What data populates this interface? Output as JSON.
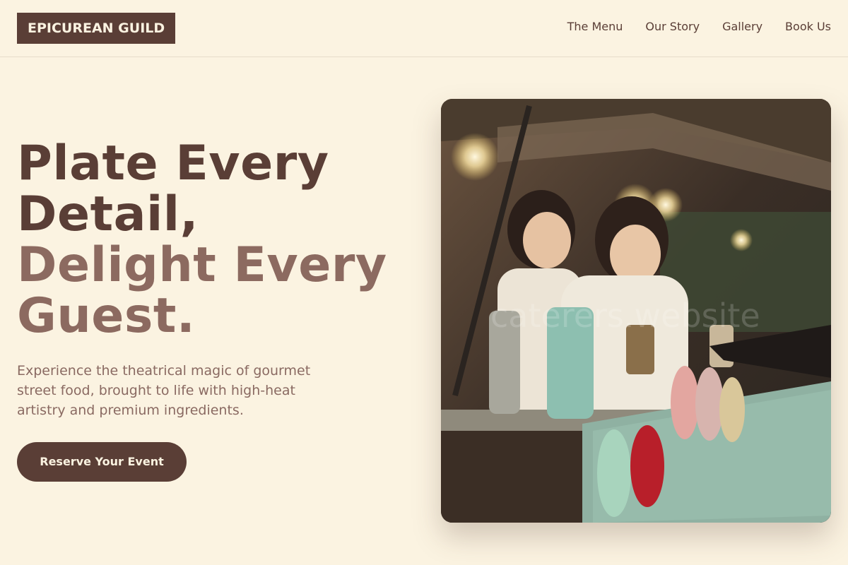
{
  "header": {
    "logo": "EPICUREAN GUILD",
    "nav": [
      "The Menu",
      "Our Story",
      "Gallery",
      "Book Us"
    ]
  },
  "hero": {
    "headline_lines": [
      "Plate Every",
      "Detail,",
      "Delight Every",
      "Guest."
    ],
    "subtitle": "Experience the theatrical magic of gourmet street food, brought to life with high-heat artistry and premium ingredients.",
    "cta_label": "Reserve Your Event",
    "image_alt": "Chefs serving at a street food stall",
    "watermark": "caterers.website"
  },
  "colors": {
    "background": "#fbf3e1",
    "primary": "#5a3e36",
    "accent_light": "#8c6a60",
    "text_muted": "#8a6a62"
  }
}
